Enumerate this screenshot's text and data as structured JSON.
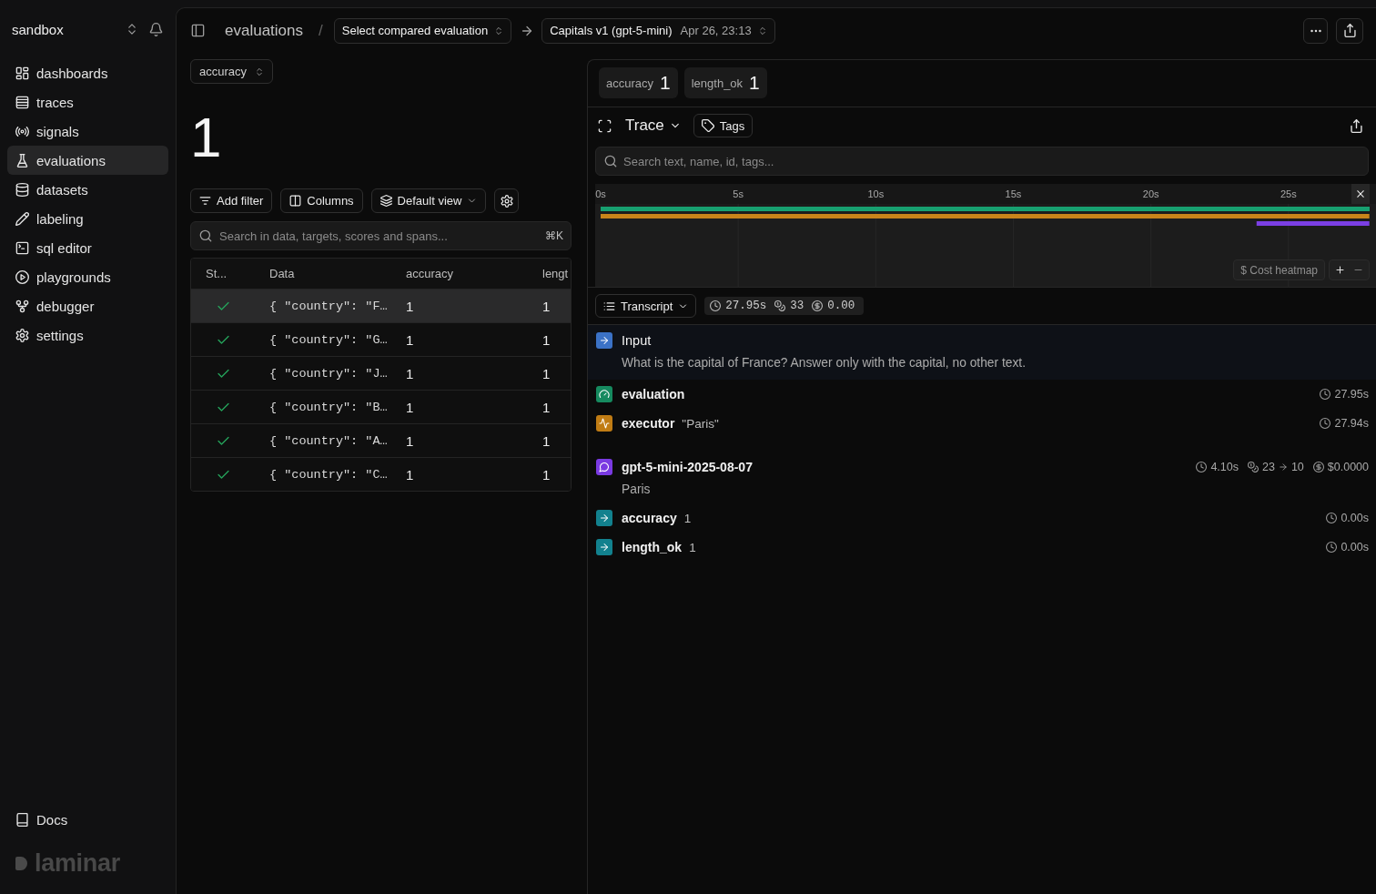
{
  "sidebar": {
    "workspace": "sandbox",
    "items": [
      {
        "label": "dashboards",
        "selected": false
      },
      {
        "label": "traces",
        "selected": false
      },
      {
        "label": "signals",
        "selected": false
      },
      {
        "label": "evaluations",
        "selected": true
      },
      {
        "label": "datasets",
        "selected": false
      },
      {
        "label": "labeling",
        "selected": false
      },
      {
        "label": "sql editor",
        "selected": false
      },
      {
        "label": "playgrounds",
        "selected": false
      },
      {
        "label": "debugger",
        "selected": false
      },
      {
        "label": "settings",
        "selected": false
      }
    ],
    "footer_link": "Docs",
    "logo": "laminar"
  },
  "header": {
    "breadcrumb": "evaluations",
    "separator": "/",
    "compare_select": "Select compared evaluation",
    "evaluation_select": {
      "value": "Capitals v1 (gpt-5-mini)",
      "date": "Apr 26, 23:13"
    }
  },
  "score_summary": {
    "score_select": "accuracy",
    "value": "1"
  },
  "toolbar": {
    "buttons": [
      {
        "label": "Add filter",
        "kind": "action"
      },
      {
        "label": "Columns",
        "kind": "action"
      },
      {
        "label": "Default view",
        "kind": "dropdown"
      }
    ]
  },
  "search": {
    "placeholder": "Search in data, targets, scores and spans...",
    "shortcut": "⌘K"
  },
  "table": {
    "columns": [
      "St...",
      "Data",
      "accuracy",
      "lengt"
    ],
    "rows": [
      {
        "selected": true,
        "passed": true,
        "cells": [
          "",
          "{ \"country\": \"F…",
          "1",
          "1"
        ]
      },
      {
        "selected": false,
        "passed": true,
        "cells": [
          "",
          "{ \"country\": \"G…",
          "1",
          "1"
        ]
      },
      {
        "selected": false,
        "passed": true,
        "cells": [
          "",
          "{ \"country\": \"J…",
          "1",
          "1"
        ]
      },
      {
        "selected": false,
        "passed": true,
        "cells": [
          "",
          "{ \"country\": \"B…",
          "1",
          "1"
        ]
      },
      {
        "selected": false,
        "passed": true,
        "cells": [
          "",
          "{ \"country\": \"A…",
          "1",
          "1"
        ]
      },
      {
        "selected": false,
        "passed": true,
        "cells": [
          "",
          "{ \"country\": \"C…",
          "1",
          "1"
        ]
      }
    ]
  },
  "trace_panel": {
    "scores": [
      {
        "name": "accuracy",
        "value": "1"
      },
      {
        "name": "length_ok",
        "value": "1"
      }
    ],
    "title": "Trace",
    "tags_button": "Tags",
    "search": {
      "placeholder": "Search text, name, id, tags..."
    },
    "timeline": {
      "chart_data": {
        "type": "bar",
        "orientation": "horizontal",
        "categories": [
          null,
          null,
          null
        ],
        "base": [
          0,
          0,
          23.84
        ],
        "values": [
          27.95,
          27.94,
          4.1
        ],
        "colors": [
          "#17a070",
          "#c8841a",
          "#7b3fe4"
        ],
        "xlim": [
          0,
          27.95
        ],
        "xticks": [
          {
            "value": 0,
            "label": "0s"
          },
          {
            "value": 5,
            "label": "5s"
          },
          {
            "value": 10,
            "label": "10s"
          },
          {
            "value": 15,
            "label": "15s"
          },
          {
            "value": 20,
            "label": "20s"
          },
          {
            "value": 25,
            "label": "25s"
          }
        ],
        "grid": true
      },
      "cost_heatmap": "$ Cost heatmap"
    },
    "view_select": "Transcript",
    "summary": {
      "duration": "27.95s",
      "tokens": "33",
      "cost": "0.00"
    },
    "spans": [
      {
        "kind": "input",
        "name": "Input",
        "detail": "What is the capital of France? Answer only with the capital, no other text."
      },
      {
        "kind": "evaluation",
        "name": "evaluation",
        "duration": "27.95s"
      },
      {
        "kind": "executor",
        "name": "executor",
        "inline": "\"Paris\"",
        "duration": "27.94s"
      },
      {
        "kind": "llm",
        "name": "gpt-5-mini-2025-08-07",
        "duration": "4.10s",
        "tokens_in": "23",
        "tokens_out": "10",
        "cost": "$0.0000",
        "detail": "Paris"
      },
      {
        "kind": "score",
        "name": "accuracy",
        "inline": "1",
        "duration": "0.00s"
      },
      {
        "kind": "score",
        "name": "length_ok",
        "inline": "1",
        "duration": "0.00s"
      }
    ]
  }
}
